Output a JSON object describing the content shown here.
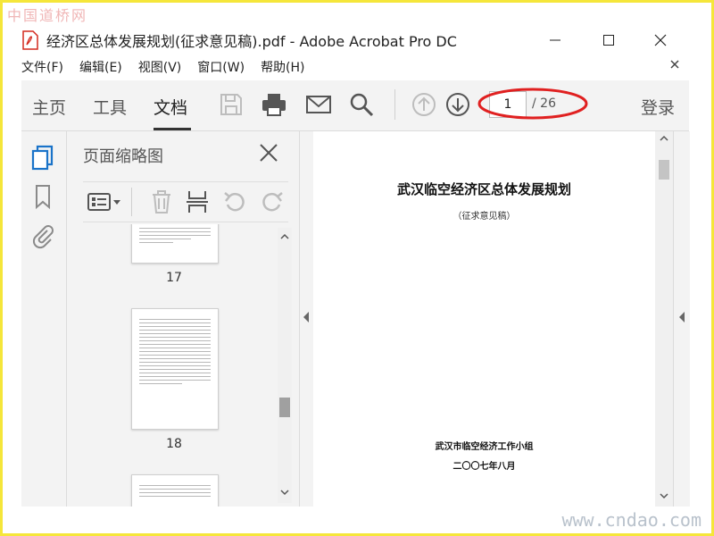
{
  "watermarks": {
    "top_left": "中国道桥网",
    "bottom_right": "www.cndao.com"
  },
  "window": {
    "title": "经济区总体发展规划(征求意见稿).pdf - Adobe Acrobat Pro DC"
  },
  "menu": {
    "items": [
      "文件(F)",
      "编辑(E)",
      "视图(V)",
      "窗口(W)",
      "帮助(H)"
    ]
  },
  "toolbar": {
    "tabs": [
      "主页",
      "工具",
      "文档"
    ],
    "active_tab": "文档",
    "icons": [
      "save-icon",
      "print-icon",
      "email-icon",
      "search-icon",
      "page-up-icon",
      "page-down-icon"
    ],
    "page_current": "1",
    "page_total": "/ 26",
    "login": "登录",
    "highlight_color": "#e02020"
  },
  "rail": {
    "icons": [
      "pages-icon",
      "bookmark-icon",
      "attachment-icon"
    ],
    "accent": "#1a73c9"
  },
  "thumbnails": {
    "title": "页面缩略图",
    "tools": [
      "options-icon",
      "delete-icon",
      "insert-icon",
      "rotate-left-icon",
      "rotate-right-icon"
    ],
    "pages": [
      {
        "label": "17"
      },
      {
        "label": "18"
      }
    ]
  },
  "document": {
    "title": "武汉临空经济区总体发展规划",
    "subtitle": "（征求意见稿）",
    "organization": "武汉市临空经济工作小组",
    "date": "二〇〇七年八月"
  }
}
